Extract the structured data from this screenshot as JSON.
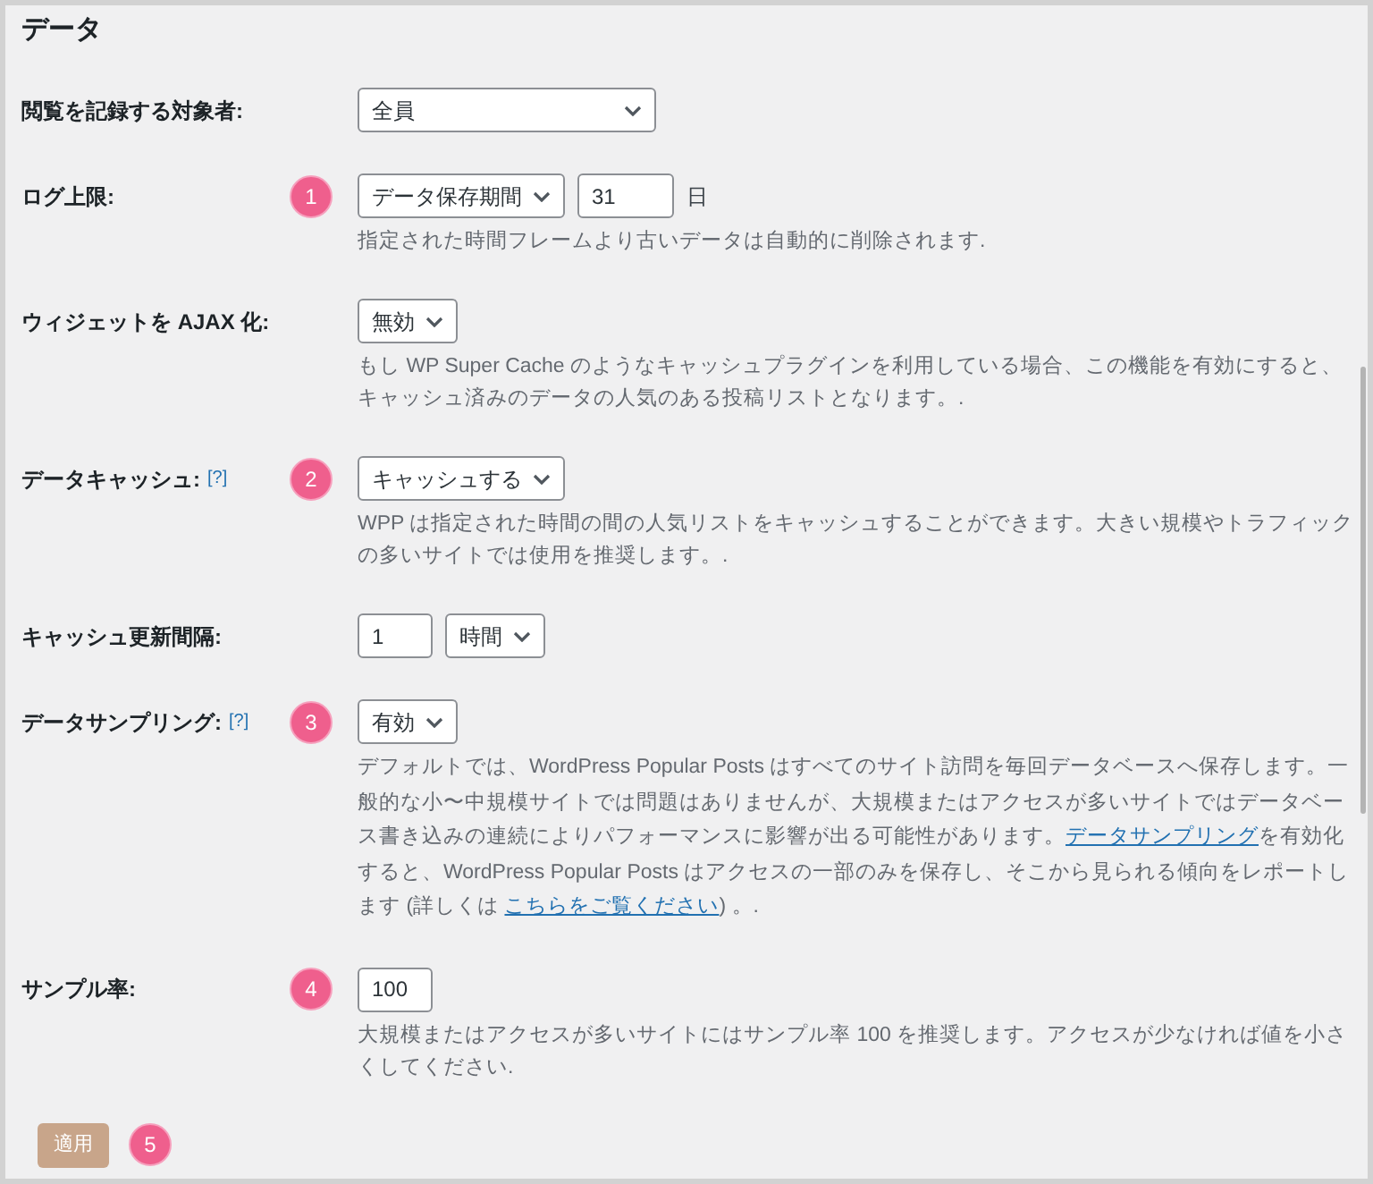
{
  "section_title": "データ",
  "settings": [
    {
      "label": "閲覧を記録する対象者:",
      "controls": [
        {
          "kind": "select",
          "value": "全員"
        }
      ]
    },
    {
      "label": "ログ上限:",
      "marker": "1",
      "controls": [
        {
          "kind": "select",
          "value": "データ保存期間"
        },
        {
          "kind": "input",
          "value": "31"
        },
        {
          "kind": "unit",
          "text": "日"
        }
      ],
      "description": [
        {
          "kind": "text",
          "text": "指定された時間フレームより古いデータは自動的に削除されます."
        }
      ]
    },
    {
      "label": "ウィジェットを AJAX 化:",
      "controls": [
        {
          "kind": "select",
          "value": "無効"
        }
      ],
      "description": [
        {
          "kind": "text",
          "text": "もし WP Super Cache のようなキャッシュプラグインを利用している場合、この機能を有効にすると、キャッシュ済みのデータの人気のある投稿リストとなります。."
        }
      ]
    },
    {
      "label": "データキャッシュ:",
      "help": "[?]",
      "marker": "2",
      "controls": [
        {
          "kind": "select",
          "value": "キャッシュする"
        }
      ],
      "description": [
        {
          "kind": "text",
          "text": "WPP は指定された時間の間の人気リストをキャッシュすることができます。大きい規模やトラフィックの多いサイトでは使用を推奨します。."
        }
      ]
    },
    {
      "label": "キャッシュ更新間隔:",
      "controls": [
        {
          "kind": "input",
          "value": "1"
        },
        {
          "kind": "select",
          "value": "時間"
        }
      ]
    },
    {
      "label": "データサンプリング:",
      "help": "[?]",
      "marker": "3",
      "controls": [
        {
          "kind": "select",
          "value": "有効"
        }
      ],
      "description": [
        {
          "kind": "text",
          "text": "デフォルトでは、WordPress Popular Posts はすべてのサイト訪問を毎回データベースへ保存します。一般的な小〜中規模サイトでは問題はありませんが、大規模またはアクセスが多いサイトではデータベース書き込みの連続によりパフォーマンスに影響が出る可能性があります。"
        },
        {
          "kind": "link",
          "text": "データサンプリング"
        },
        {
          "kind": "text",
          "text": "を有効化すると、WordPress Popular Posts はアクセスの一部のみを保存し、そこから見られる傾向をレポートします (詳しくは "
        },
        {
          "kind": "link",
          "text": "こちらをご覧ください"
        },
        {
          "kind": "text",
          "text": ") 。."
        }
      ]
    },
    {
      "label": "サンプル率:",
      "marker": "4",
      "controls": [
        {
          "kind": "input",
          "value": "100"
        }
      ],
      "description": [
        {
          "kind": "text",
          "text": "大規模またはアクセスが多いサイトにはサンプル率 100 を推奨します。アクセスが少なければ値を小さくしてください."
        }
      ]
    }
  ],
  "apply_button": {
    "label": "適用",
    "marker": "5"
  }
}
